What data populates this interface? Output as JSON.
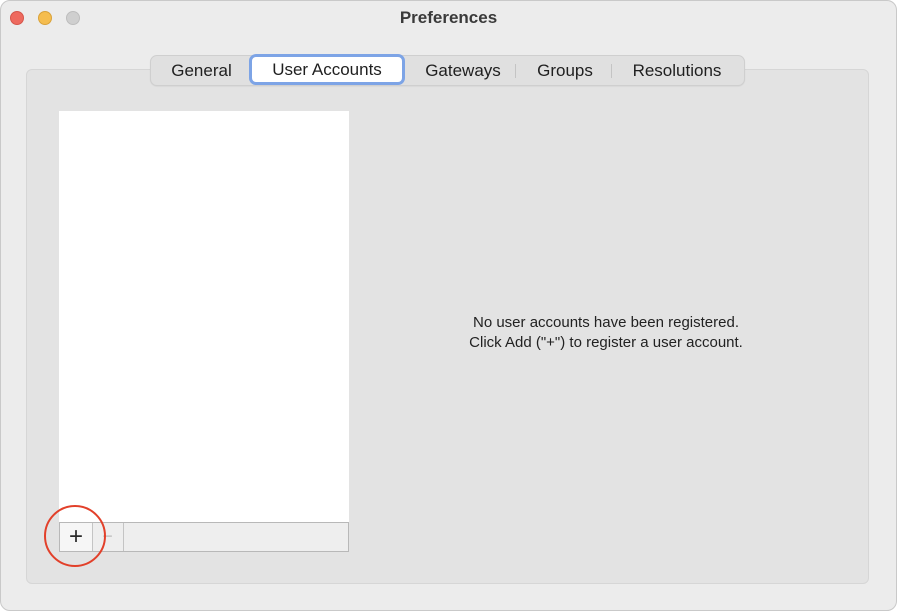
{
  "window": {
    "title": "Preferences"
  },
  "tabs": [
    {
      "label": "General",
      "selected": false
    },
    {
      "label": "User Accounts",
      "selected": true
    },
    {
      "label": "Gateways",
      "selected": false
    },
    {
      "label": "Groups",
      "selected": false
    },
    {
      "label": "Resolutions",
      "selected": false
    }
  ],
  "accounts": {
    "items": [],
    "add_label": "+",
    "remove_label": "−",
    "empty_line1": "No user accounts have been registered.",
    "empty_line2": "Click Add (\"+\") to register a user account."
  },
  "colors": {
    "accent": "#7da4e6",
    "highlight": "#e2402a"
  }
}
